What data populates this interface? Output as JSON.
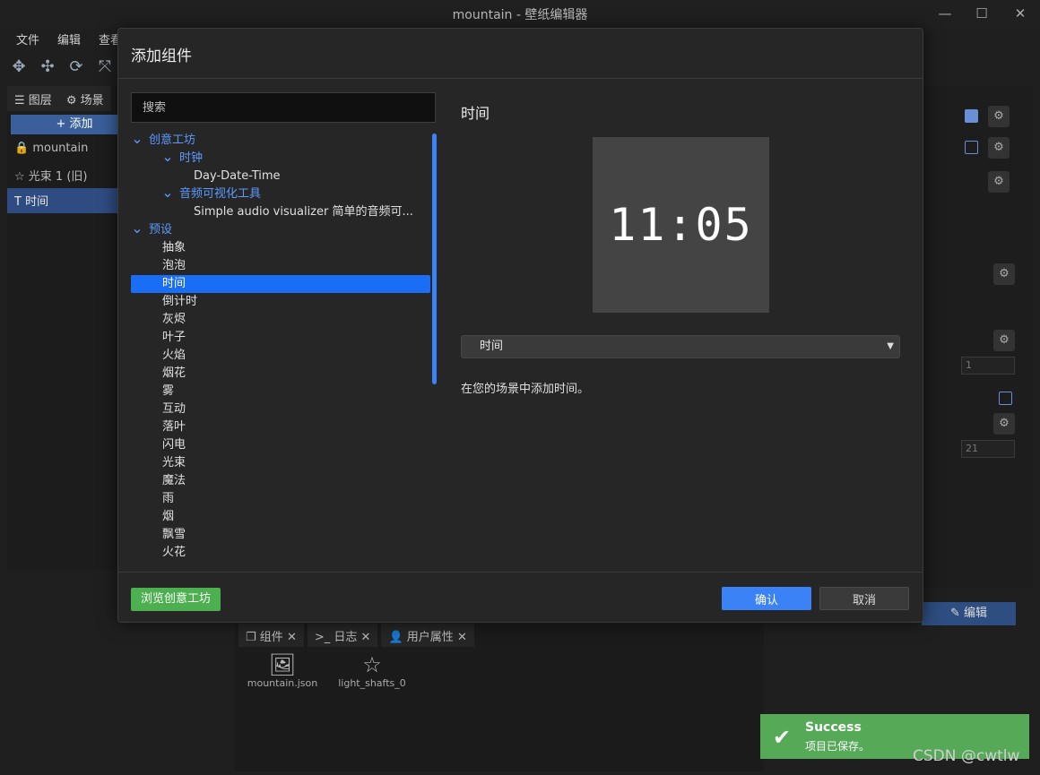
{
  "window": {
    "title": "mountain - 壁纸编辑器",
    "minimize": "—",
    "maximize": "☐",
    "close": "✕"
  },
  "menu": [
    "文件",
    "编辑",
    "查看"
  ],
  "left_panel": {
    "tabs": [
      "图层",
      "场景"
    ],
    "add_button": "+ 添加",
    "layers": [
      "mountain",
      "光束 1 (旧)",
      "时间"
    ]
  },
  "right_panel": {
    "field1": "1",
    "field2": "21",
    "edit_button": "编辑"
  },
  "bottom": {
    "tabs": [
      "组件",
      "日志",
      "用户属性"
    ],
    "assets": [
      "mountain.json",
      "light_shafts_0"
    ]
  },
  "dialog": {
    "title": "添加组件",
    "search_placeholder": "搜索",
    "tree": [
      {
        "label": "创意工坊",
        "level": 0,
        "folder": true
      },
      {
        "label": "时钟",
        "level": 1,
        "folder": true
      },
      {
        "label": "Day-Date-Time",
        "level": 2,
        "folder": false
      },
      {
        "label": "音频可视化工具",
        "level": 1,
        "folder": true
      },
      {
        "label": "Simple audio visualizer 简单的音频可...",
        "level": 2,
        "folder": false
      },
      {
        "label": "预设",
        "level": 0,
        "folder": true
      },
      {
        "label": "抽象",
        "level": 1,
        "folder": false
      },
      {
        "label": "泡泡",
        "level": 1,
        "folder": false
      },
      {
        "label": "时间",
        "level": 1,
        "folder": false,
        "selected": true
      },
      {
        "label": "倒计时",
        "level": 1,
        "folder": false
      },
      {
        "label": "灰烬",
        "level": 1,
        "folder": false
      },
      {
        "label": "叶子",
        "level": 1,
        "folder": false
      },
      {
        "label": "火焰",
        "level": 1,
        "folder": false
      },
      {
        "label": "烟花",
        "level": 1,
        "folder": false
      },
      {
        "label": "雾",
        "level": 1,
        "folder": false
      },
      {
        "label": "互动",
        "level": 1,
        "folder": false
      },
      {
        "label": "落叶",
        "level": 1,
        "folder": false
      },
      {
        "label": "闪电",
        "level": 1,
        "folder": false
      },
      {
        "label": "光束",
        "level": 1,
        "folder": false
      },
      {
        "label": "魔法",
        "level": 1,
        "folder": false
      },
      {
        "label": "雨",
        "level": 1,
        "folder": false
      },
      {
        "label": "烟",
        "level": 1,
        "folder": false
      },
      {
        "label": "飘雪",
        "level": 1,
        "folder": false
      },
      {
        "label": "火花",
        "level": 1,
        "folder": false
      }
    ],
    "preview_title": "时间",
    "preview_clock": "11:05",
    "select_value": "时间",
    "description": "在您的场景中添加时间。",
    "browse_button": "浏览创意工坊",
    "ok_button": "确认",
    "cancel_button": "取消"
  },
  "toast": {
    "title": "Success",
    "message": "项目已保存。"
  },
  "watermark": "CSDN @cwtlw",
  "colors": {
    "accent": "#3b82f6",
    "selected": "#1a6ef5",
    "folder_text": "#5c9aff",
    "success": "#55a957"
  }
}
